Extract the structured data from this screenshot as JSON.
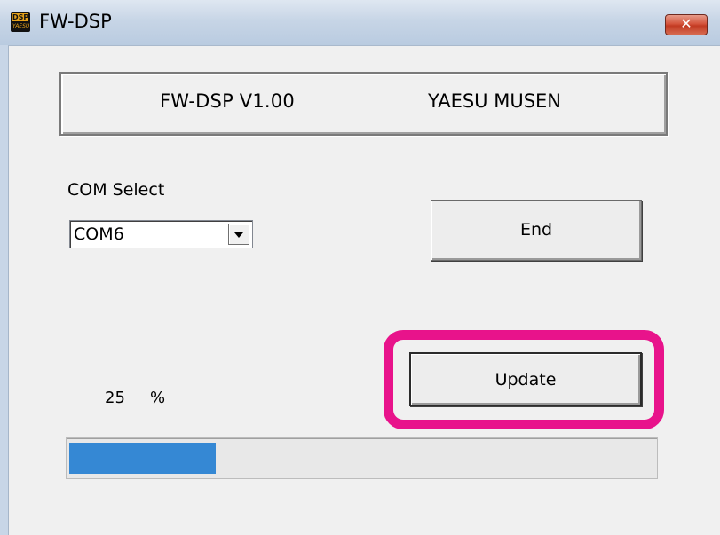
{
  "window": {
    "title": "FW-DSP",
    "icon_name": "dsp-app-icon",
    "icon_text_top": "DSP",
    "icon_text_bottom": "YAESU",
    "close_label": "✕"
  },
  "header": {
    "version_text": "FW-DSP  V1.00",
    "maker_text": "YAESU MUSEN"
  },
  "com": {
    "label": "COM Select",
    "selected": "COM6"
  },
  "buttons": {
    "end_label": "End",
    "update_label": "Update"
  },
  "progress": {
    "percent_value": "25",
    "percent_unit": "%",
    "fraction": 0.25
  },
  "colors": {
    "highlight": "#e8138b",
    "progress_fill": "#3588d4"
  }
}
